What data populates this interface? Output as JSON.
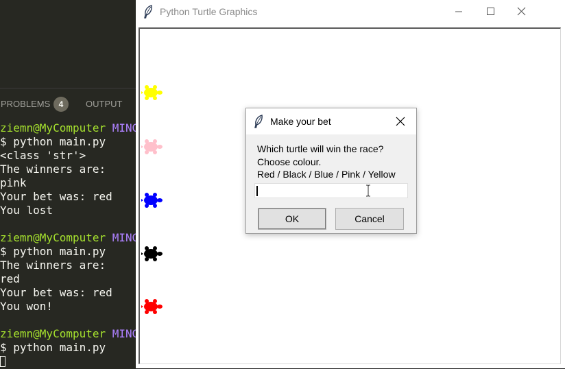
{
  "panel": {
    "tabs": [
      {
        "label": "PROBLEMS",
        "badge": "4"
      },
      {
        "label": "OUTPUT"
      }
    ]
  },
  "terminal": {
    "lines": [
      {
        "user": "ziemn@MyComputer",
        "host": " MINGW"
      },
      {
        "text": "$ python main.py"
      },
      {
        "text": "<class 'str'>"
      },
      {
        "text": "The winners are:"
      },
      {
        "text": "pink"
      },
      {
        "text": "Your bet was: red"
      },
      {
        "text": "You lost"
      },
      {
        "text": ""
      },
      {
        "user": "ziemn@MyComputer",
        "host": " MINGW"
      },
      {
        "text": "$ python main.py"
      },
      {
        "text": "The winners are:"
      },
      {
        "text": "red"
      },
      {
        "text": "Your bet was: red"
      },
      {
        "text": "You won!"
      },
      {
        "text": ""
      },
      {
        "user": "ziemn@MyComputer",
        "host": " MINGW"
      },
      {
        "text": "$ python main.py"
      }
    ]
  },
  "window": {
    "title": "Python Turtle Graphics"
  },
  "turtles": [
    {
      "color": "#ffff00"
    },
    {
      "color": "#ffc0cb"
    },
    {
      "color": "#0000ff"
    },
    {
      "color": "#000000"
    },
    {
      "color": "#ff0000"
    }
  ],
  "dialog": {
    "title": "Make your bet",
    "prompt": [
      "Which turtle will win the race?",
      "Choose colour.",
      "Red / Black / Blue / Pink / Yellow"
    ],
    "input_value": "",
    "ok_label": "OK",
    "cancel_label": "Cancel"
  }
}
